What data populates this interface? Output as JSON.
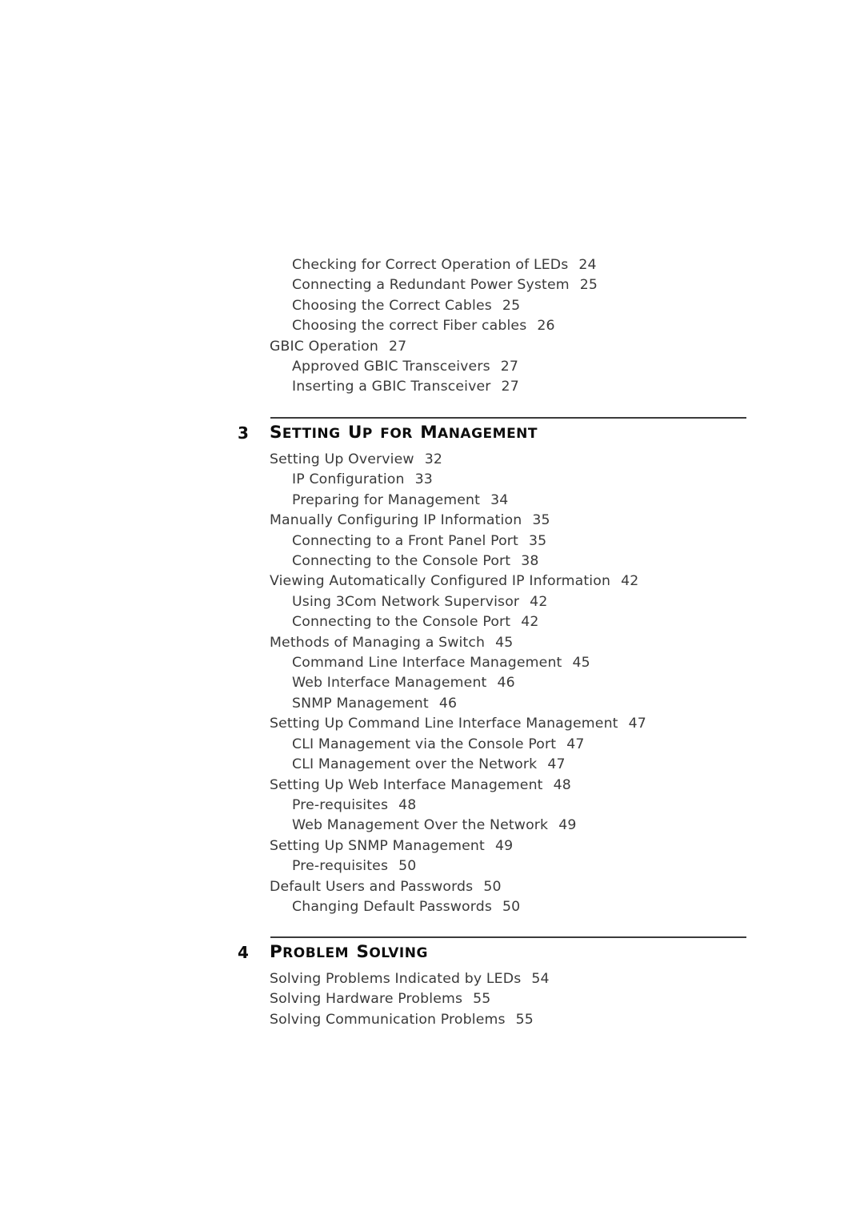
{
  "document": {
    "type": "table-of-contents",
    "page_background": "#ffffff",
    "text_color": "#3a3a3a",
    "heading_color": "#0d0d0d"
  },
  "toc_top": {
    "entries": [
      {
        "level": 2,
        "text": "Checking for Correct Operation of LEDs",
        "page": "24"
      },
      {
        "level": 2,
        "text": "Connecting a Redundant Power System",
        "page": "25"
      },
      {
        "level": 2,
        "text": "Choosing the Correct Cables",
        "page": "25"
      },
      {
        "level": 2,
        "text": "Choosing the correct Fiber cables",
        "page": "26"
      },
      {
        "level": 1,
        "text": "GBIC Operation",
        "page": "27"
      },
      {
        "level": 2,
        "text": "Approved GBIC Transceivers",
        "page": "27"
      },
      {
        "level": 2,
        "text": "Inserting a GBIC Transceiver",
        "page": "27"
      }
    ]
  },
  "chapters": [
    {
      "number": "3",
      "title": "Setting Up for Management",
      "title_words": [
        {
          "cap": "S",
          "rest": "ETTING"
        },
        {
          "cap": "U",
          "rest": "P"
        },
        {
          "cap": "",
          "rest": "FOR"
        },
        {
          "cap": "M",
          "rest": "ANAGEMENT"
        }
      ],
      "entries": [
        {
          "level": 1,
          "text": "Setting Up Overview",
          "page": "32"
        },
        {
          "level": 2,
          "text": "IP Configuration",
          "page": "33"
        },
        {
          "level": 2,
          "text": "Preparing for Management",
          "page": "34"
        },
        {
          "level": 1,
          "text": "Manually Configuring IP Information",
          "page": "35"
        },
        {
          "level": 2,
          "text": "Connecting to a Front Panel Port",
          "page": "35"
        },
        {
          "level": 2,
          "text": "Connecting to the Console Port",
          "page": "38"
        },
        {
          "level": 1,
          "text": "Viewing Automatically Configured IP Information",
          "page": "42"
        },
        {
          "level": 2,
          "text": "Using 3Com Network Supervisor",
          "page": "42"
        },
        {
          "level": 2,
          "text": "Connecting to the Console Port",
          "page": "42"
        },
        {
          "level": 1,
          "text": "Methods of Managing a Switch",
          "page": "45"
        },
        {
          "level": 2,
          "text": "Command Line Interface Management",
          "page": "45"
        },
        {
          "level": 2,
          "text": "Web Interface Management",
          "page": "46"
        },
        {
          "level": 2,
          "text": "SNMP Management",
          "page": "46"
        },
        {
          "level": 1,
          "text": "Setting Up Command Line Interface Management",
          "page": "47"
        },
        {
          "level": 2,
          "text": "CLI Management via the Console Port",
          "page": "47"
        },
        {
          "level": 2,
          "text": "CLI Management over the Network",
          "page": "47"
        },
        {
          "level": 1,
          "text": "Setting Up Web Interface Management",
          "page": "48"
        },
        {
          "level": 2,
          "text": "Pre-requisites",
          "page": "48"
        },
        {
          "level": 2,
          "text": "Web Management Over the Network",
          "page": "49"
        },
        {
          "level": 1,
          "text": "Setting Up SNMP Management",
          "page": "49"
        },
        {
          "level": 2,
          "text": "Pre-requisites",
          "page": "50"
        },
        {
          "level": 1,
          "text": "Default Users and Passwords",
          "page": "50"
        },
        {
          "level": 2,
          "text": "Changing Default Passwords",
          "page": "50"
        }
      ]
    },
    {
      "number": "4",
      "title": "Problem Solving",
      "title_words": [
        {
          "cap": "P",
          "rest": "ROBLEM"
        },
        {
          "cap": "S",
          "rest": "OLVING"
        }
      ],
      "entries": [
        {
          "level": 1,
          "text": "Solving Problems Indicated by LEDs",
          "page": "54"
        },
        {
          "level": 1,
          "text": "Solving Hardware Problems",
          "page": "55"
        },
        {
          "level": 1,
          "text": "Solving Communication Problems",
          "page": "55"
        }
      ]
    }
  ]
}
